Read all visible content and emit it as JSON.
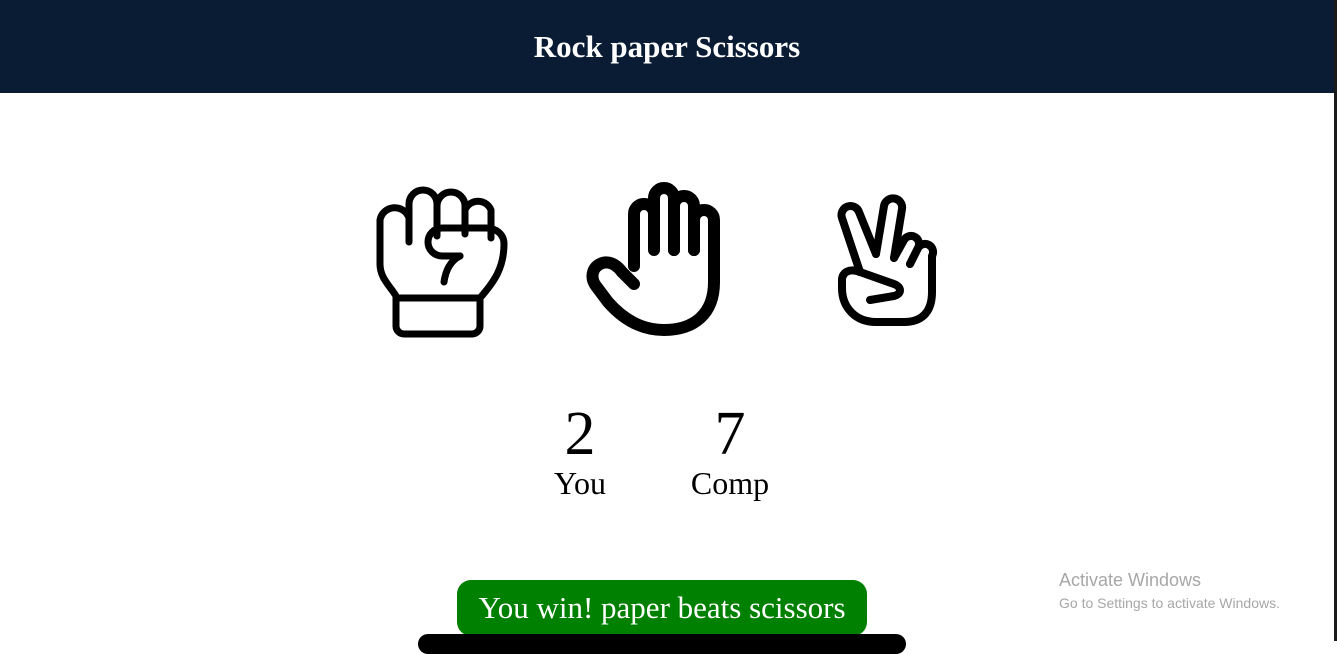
{
  "header": {
    "title": "Rock paper Scissors"
  },
  "choices": [
    {
      "id": "rock",
      "icon": "rock-fist-icon"
    },
    {
      "id": "paper",
      "icon": "paper-hand-icon"
    },
    {
      "id": "scissors",
      "icon": "scissors-hand-icon"
    }
  ],
  "scoreboard": {
    "user": {
      "score": "2",
      "label": "You"
    },
    "comp": {
      "score": "7",
      "label": "Comp"
    }
  },
  "message": {
    "text": "You win! paper beats scissors",
    "color": "#008000"
  },
  "watermark": {
    "title": "Activate Windows",
    "subtitle": "Go to Settings to activate Windows."
  },
  "colors": {
    "header_bg": "#0a1c33",
    "message_bg": "#008000"
  }
}
